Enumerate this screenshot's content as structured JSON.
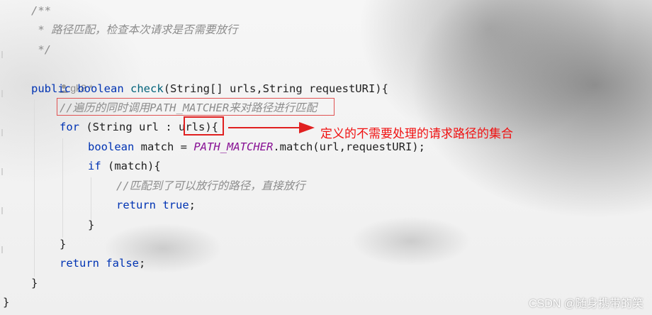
{
  "editor": {
    "lines": {
      "l1": "/**",
      "l2": " * 路径匹配，检查本次请求是否需要放行",
      "l3": " */",
      "author": "gk8 *",
      "l5_public": "public",
      "l5_boolean": "boolean",
      "l5_fn": "check",
      "l5_rest": "(String[] urls,String requestURI){",
      "l6_comment": "//遍历的同时调用PATH_MATCHER来对路径进行匹配",
      "l7_for": "for",
      "l7_a": " (String url : ",
      "l7_urls": "urls",
      "l7_b": "){",
      "l8_boolean": "boolean",
      "l8_a": " match = ",
      "l8_const": "PATH_MATCHER",
      "l8_b": ".match(url,requestURI);",
      "l9_if": "if",
      "l9_a": " (match){",
      "l10_comment": "//匹配到了可以放行的路径，直接放行",
      "l11_return": "return",
      "l11_true": "true",
      "l11_semi": ";",
      "l12": "}",
      "l13": "}",
      "l14_return": "return",
      "l14_false": "false",
      "l14_semi": ";",
      "l15": "}",
      "l16": "}"
    }
  },
  "annotation": {
    "text": "定义的不需要处理的请求路径的集合",
    "color": "#f01010"
  },
  "watermark": "CSDN @随身携带的笑",
  "colors": {
    "keyword": "#0033b3",
    "function": "#00627a",
    "comment": "#8c8c8c",
    "constant": "#871094",
    "highlight_box": "#e02020"
  },
  "icons": {
    "author": "user-icon",
    "arrow": "arrow-right-icon"
  }
}
